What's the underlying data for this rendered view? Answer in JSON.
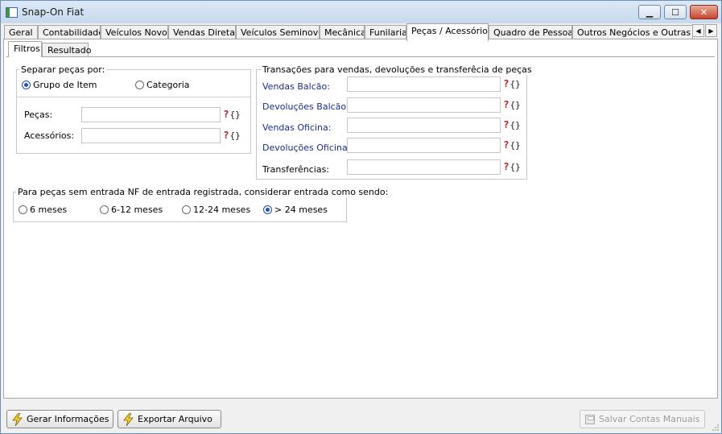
{
  "window": {
    "title": "Snap-On Fiat",
    "controls": {
      "minimize": "▁",
      "maximize": "☐",
      "close": "✕"
    }
  },
  "tabs": [
    {
      "label": "Geral"
    },
    {
      "label": "Contabilidade"
    },
    {
      "label": "Veículos Novos"
    },
    {
      "label": "Vendas Diretas"
    },
    {
      "label": "Veículos Seminovos"
    },
    {
      "label": "Mecânica"
    },
    {
      "label": "Funilaria"
    },
    {
      "label": "Peças / Acessórios"
    },
    {
      "label": "Quadro de Pessoas"
    },
    {
      "label": "Outros Negócios e Outras Mar"
    }
  ],
  "tab_scroll": {
    "left": "◀",
    "right": "▶"
  },
  "subtabs": [
    {
      "label": "Filtros"
    },
    {
      "label": "Resultado"
    }
  ],
  "separar": {
    "legend": "Separar peças por:",
    "options": [
      {
        "label": "Grupo de Item",
        "selected": true
      },
      {
        "label": "Categoria",
        "selected": false
      }
    ],
    "fields": [
      {
        "label": "Peças:",
        "value": ""
      },
      {
        "label": "Acessórios:",
        "value": ""
      }
    ]
  },
  "transacoes": {
    "legend": "Transações para vendas, devoluções e transferêcia de peças",
    "fields": [
      {
        "label": "Vendas Balcão:",
        "value": ""
      },
      {
        "label": "Devoluções Balcão:",
        "value": ""
      },
      {
        "label": "Vendas Oficina:",
        "value": ""
      },
      {
        "label": "Devoluções Oficina:",
        "value": ""
      },
      {
        "label": "Transferências:",
        "value": ""
      }
    ]
  },
  "entrada": {
    "legend": "Para peças sem entrada NF de entrada registrada, considerar entrada como sendo:",
    "options": [
      {
        "label": "6 meses",
        "selected": false
      },
      {
        "label": "6-12 meses",
        "selected": false
      },
      {
        "label": "12-24 meses",
        "selected": false
      },
      {
        "label": "> 24 meses",
        "selected": true
      }
    ]
  },
  "lookup_button": {
    "glyph": "?",
    "brace": "{}"
  },
  "buttons": {
    "gerar": "Gerar Informações",
    "exportar": "Exportar Arquivo",
    "salvar": "Salvar Contas Manuais"
  },
  "colors": {
    "accent": "#1756c0",
    "label_blue": "#1a2d8c",
    "lookup_red": "#c0181b"
  }
}
